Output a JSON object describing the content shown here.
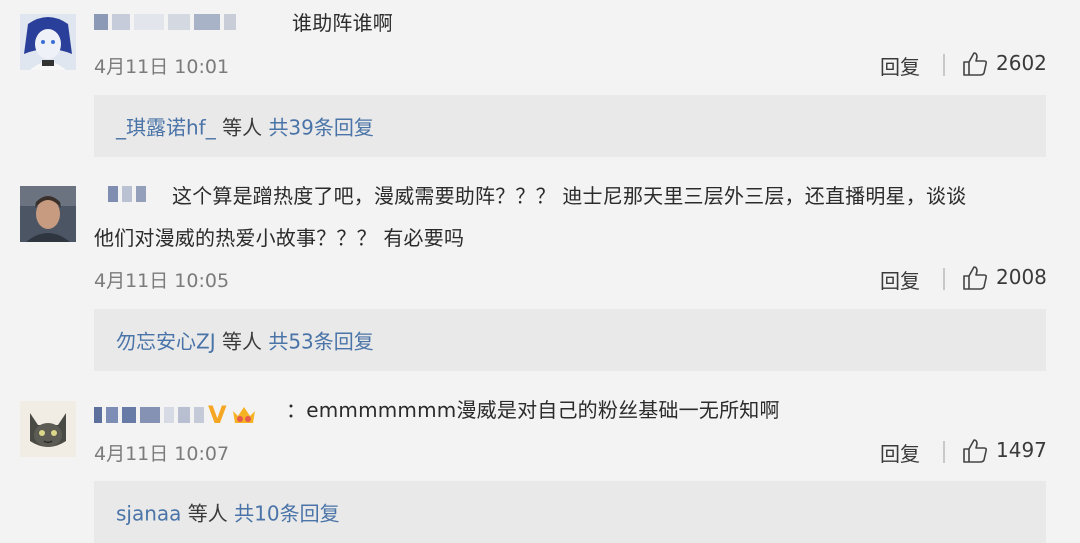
{
  "comments": [
    {
      "text": "谁助阵谁啊",
      "time": "4月11日 10:01",
      "reply_label": "回复",
      "likes": "2602",
      "replies": {
        "user": "_琪露诺hf_",
        "mid": "等人",
        "count": "共39条回复"
      }
    },
    {
      "text_line1": "这个算是蹭热度了吧，漫威需要助阵？？？ 迪士尼那天里三层外三层，还直播明星，谈谈",
      "text_line2": "他们对漫威的热爱小故事？？？ 有必要吗",
      "time": "4月11日 10:05",
      "reply_label": "回复",
      "likes": "2008",
      "replies": {
        "user": "勿忘安心ZJ",
        "mid": "等人",
        "count": "共53条回复"
      }
    },
    {
      "text": "：emmmmmmm漫威是对自己的粉丝基础一无所知啊",
      "badge": "V",
      "time": "4月11日 10:07",
      "reply_label": "回复",
      "likes": "1497",
      "replies": {
        "user": "sjanaa",
        "mid": "等人",
        "count": "共10条回复"
      }
    }
  ],
  "icons": {
    "like": "thumbs-up-icon",
    "crown": "crown-icon"
  },
  "colors": {
    "link": "#4a74a8",
    "background": "#f3f3f3",
    "reply_box": "#e9e9e9",
    "vip": "#f5a623"
  }
}
